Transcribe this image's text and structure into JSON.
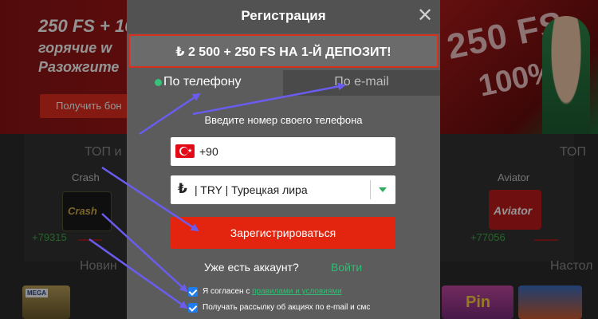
{
  "background": {
    "promo": {
      "line1": "250 FS + 10",
      "line2": "горячие w",
      "line3": "Разожгите",
      "button_label": "Получить бон",
      "deco_line1": "250 FS",
      "deco_line2": "100%"
    },
    "top_title_left": "ТОП и",
    "top_title_right": "ТОП",
    "new_title_left": "Новин",
    "new_title_right": "Настол",
    "games": {
      "crash": {
        "name": "Crash",
        "tile_text": "Crash",
        "stat": "+79315"
      },
      "aviator": {
        "name": "Aviator",
        "tile_text": "Aviator",
        "stat": "+77056"
      }
    },
    "thumbs": {
      "first_label": "MEGA",
      "second_label": "Pin"
    }
  },
  "modal": {
    "title": "Регистрация",
    "close_symbol": "✕",
    "bonus_text": "₺ 2 500 + 250 FS НА 1-Й ДЕПОЗИТ!",
    "tabs": [
      {
        "label": "По телефону",
        "active": true
      },
      {
        "label": "По e-mail",
        "active": false
      }
    ],
    "prompt": "Введите номер своего телефона",
    "phone": {
      "country_code": "+90",
      "flag": "turkey-flag"
    },
    "currency": {
      "symbol": "₺",
      "text": "| TRY | Турецкая лира"
    },
    "register_label": "Зарегистрироваться",
    "has_account": "Уже есть аккаунт?",
    "login_label": "Войти",
    "consent": {
      "terms_prefix": "Я согласен с ",
      "terms_link": "правилами и условиями",
      "newsletter": "Получать рассылку об акциях по e-mail и смс"
    }
  },
  "colors": {
    "accent_red": "#e3250f",
    "accent_green": "#2fbd73",
    "checkbox_blue": "#1e7bf0",
    "annotation_arrow": "#6b5cf0"
  }
}
